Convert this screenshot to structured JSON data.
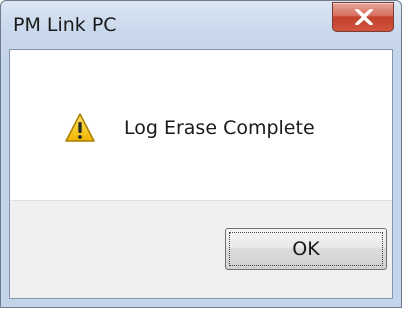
{
  "window": {
    "title": "PM Link PC",
    "close_icon": "close-x-icon"
  },
  "dialog": {
    "icon": "warning-triangle-icon",
    "message": "Log Erase Complete",
    "ok_label": "OK"
  },
  "colors": {
    "close_button": "#c94a34",
    "warning_yellow": "#f4c20d",
    "footer_bg": "#f0f0f0"
  }
}
